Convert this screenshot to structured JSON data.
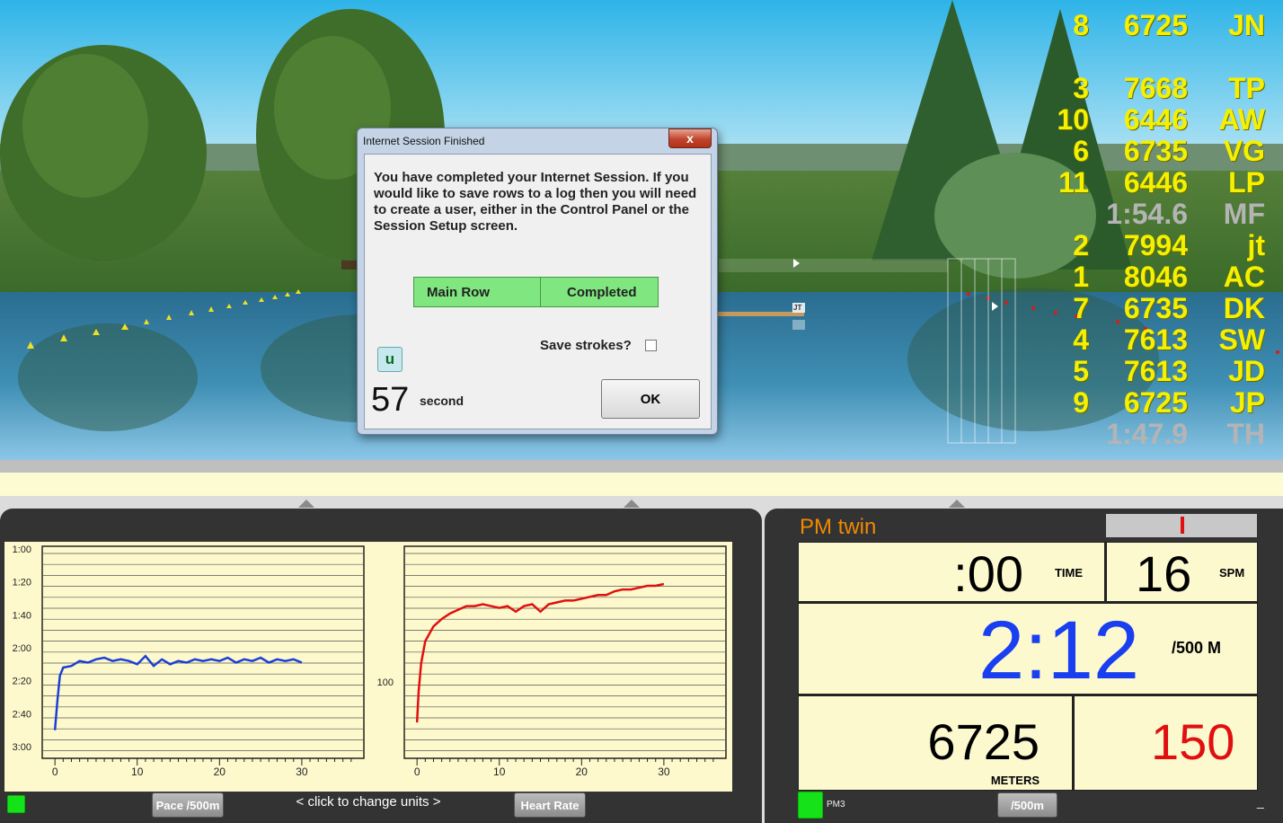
{
  "standings": [
    {
      "rank": "8",
      "value": "6725",
      "initials": "JN",
      "grey": false
    },
    {
      "rank": "",
      "value": "",
      "initials": "",
      "grey": false
    },
    {
      "rank": "3",
      "value": "7668",
      "initials": "TP",
      "grey": false
    },
    {
      "rank": "10",
      "value": "6446",
      "initials": "AW",
      "grey": false
    },
    {
      "rank": "6",
      "value": "6735",
      "initials": "VG",
      "grey": false
    },
    {
      "rank": "11",
      "value": "6446",
      "initials": "LP",
      "grey": false
    },
    {
      "rank": "",
      "value": "1:54.6",
      "initials": "MF",
      "grey": true
    },
    {
      "rank": "2",
      "value": "7994",
      "initials": "jt",
      "grey": false
    },
    {
      "rank": "1",
      "value": "8046",
      "initials": "AC",
      "grey": false
    },
    {
      "rank": "7",
      "value": "6735",
      "initials": "DK",
      "grey": false
    },
    {
      "rank": "4",
      "value": "7613",
      "initials": "SW",
      "grey": false
    },
    {
      "rank": "5",
      "value": "7613",
      "initials": "JD",
      "grey": false
    },
    {
      "rank": "9",
      "value": "6725",
      "initials": "JP",
      "grey": false
    },
    {
      "rank": "",
      "value": "1:47.9",
      "initials": "TH",
      "grey": true
    }
  ],
  "boat_tag": "JT",
  "dialog": {
    "title": "Internet Session Finished",
    "close_glyph": "x",
    "message": "You have completed your Internet Session.  If you would like to save rows to a log then you will need to create a user, either in the Control Panel or the Session Setup screen.",
    "row_name": "Main Row",
    "row_status": "Completed",
    "save_label": "Save strokes?",
    "u_label": "u",
    "countdown": "57",
    "countdown_unit": "second",
    "ok_label": "OK"
  },
  "charts": {
    "change_units": "<  click to change units  >",
    "pace_button": "Pace /500m",
    "hr_button": "Heart Rate"
  },
  "chart_data": [
    {
      "type": "line",
      "name": "pace",
      "y_ticks": [
        "1:00",
        "1:20",
        "1:40",
        "2:00",
        "2:20",
        "2:40",
        "3:00"
      ],
      "x_ticks": [
        "0",
        "10",
        "20",
        "30"
      ],
      "ylim_seconds": [
        60,
        180
      ],
      "xlim": [
        -1,
        37
      ],
      "color": "#1a3fd8",
      "x": [
        0,
        0.3,
        0.6,
        1,
        2,
        3,
        4,
        5,
        6,
        7,
        8,
        9,
        10,
        11,
        12,
        13,
        14,
        15,
        16,
        17,
        18,
        19,
        20,
        21,
        22,
        23,
        24,
        25,
        26,
        27,
        28,
        29,
        30
      ],
      "y": [
        170,
        152,
        137,
        132,
        131,
        128,
        129,
        127,
        126,
        128,
        127,
        128,
        130,
        125,
        131,
        127,
        130,
        128,
        129,
        127,
        128,
        127,
        128,
        126,
        129,
        127,
        128,
        126,
        129,
        127,
        128,
        127,
        129
      ]
    },
    {
      "type": "line",
      "name": "heart-rate",
      "y_ticks": [
        "100"
      ],
      "x_ticks": [
        "0",
        "10",
        "20",
        "30"
      ],
      "ylim": [
        60,
        170
      ],
      "xlim": [
        -1,
        37
      ],
      "color": "#e01010",
      "x": [
        0,
        0.2,
        0.5,
        1,
        2,
        3,
        4,
        5,
        6,
        7,
        8,
        9,
        10,
        11,
        12,
        13,
        14,
        15,
        16,
        17,
        18,
        19,
        20,
        21,
        22,
        23,
        24,
        25,
        26,
        27,
        28,
        29,
        30
      ],
      "y": [
        78,
        95,
        110,
        122,
        130,
        134,
        137,
        139,
        141,
        141,
        142,
        141,
        140,
        141,
        138,
        141,
        142,
        138,
        142,
        143,
        144,
        144,
        145,
        146,
        147,
        147,
        149,
        150,
        150,
        151,
        152,
        152,
        153
      ]
    }
  ],
  "monitor": {
    "title": "PM twin",
    "time_value": ":00",
    "time_label": "TIME",
    "spm_value": "16",
    "spm_label": "SPM",
    "pace_value": "2:12",
    "pace_label": "/500 M",
    "meters_value": "6725",
    "meters_label": "METERS",
    "hr_value": "150",
    "pm_label": "PM3",
    "unit_button": "/500m",
    "minimize": "_"
  },
  "colors": {
    "pace_digits": "#1a3ff0",
    "hr_digits": "#e01010",
    "monitor_title": "#f08a00",
    "standings": "#f4f000"
  }
}
